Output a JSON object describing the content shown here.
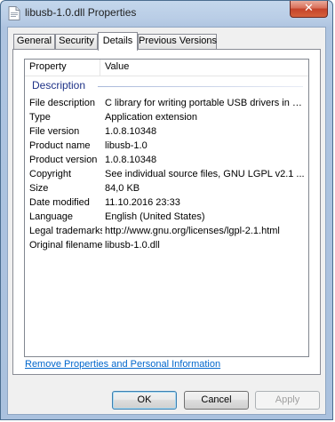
{
  "window": {
    "title": "libusb-1.0.dll Properties",
    "close_label": "✕"
  },
  "tabs": [
    {
      "label": "General"
    },
    {
      "label": "Security"
    },
    {
      "label": "Details"
    },
    {
      "label": "Previous Versions"
    }
  ],
  "active_tab": "Details",
  "listview": {
    "headers": {
      "property": "Property",
      "value": "Value"
    },
    "group": "Description",
    "rows": [
      {
        "property": "File description",
        "value": "C library for writing portable USB drivers in us..."
      },
      {
        "property": "Type",
        "value": "Application extension"
      },
      {
        "property": "File version",
        "value": "1.0.8.10348"
      },
      {
        "property": "Product name",
        "value": "libusb-1.0"
      },
      {
        "property": "Product version",
        "value": "1.0.8.10348"
      },
      {
        "property": "Copyright",
        "value": "See individual source files, GNU LGPL v2.1 ..."
      },
      {
        "property": "Size",
        "value": "84,0 KB"
      },
      {
        "property": "Date modified",
        "value": "11.10.2016 23:33"
      },
      {
        "property": "Language",
        "value": "English (United States)"
      },
      {
        "property": "Legal trademarks",
        "value": "http://www.gnu.org/licenses/lgpl-2.1.html"
      },
      {
        "property": "Original filename",
        "value": "libusb-1.0.dll"
      }
    ]
  },
  "remove_link": "Remove Properties and Personal Information",
  "buttons": {
    "ok": "OK",
    "cancel": "Cancel",
    "apply": "Apply"
  },
  "colors": {
    "link": "#0066cc",
    "group_header": "#1e3287",
    "close_button": "#c4432a"
  }
}
